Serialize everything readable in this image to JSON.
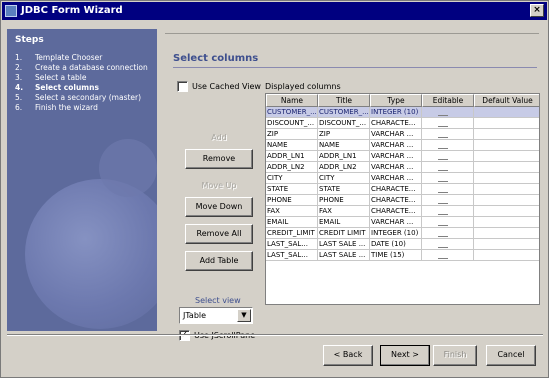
{
  "window": {
    "title": "JDBC Form Wizard",
    "close_glyph": "×"
  },
  "steps": {
    "title": "Steps",
    "items": [
      {
        "num": "1.",
        "label": "Template Chooser"
      },
      {
        "num": "2.",
        "label": "Create a database connection"
      },
      {
        "num": "3.",
        "label": "Select a table"
      },
      {
        "num": "4.",
        "label": "Select columns"
      },
      {
        "num": "5.",
        "label": "Select a secondary (master)"
      },
      {
        "num": "6.",
        "label": "Finish the wizard"
      }
    ],
    "current_index": 3
  },
  "panel": {
    "heading": "Select columns",
    "use_cached_view_label": "Use Cached View",
    "use_cached_view_checked": false,
    "displayed_columns_label": "Displayed columns",
    "buttons": {
      "add": "Add",
      "remove": "Remove",
      "move_up": "Move Up",
      "move_down": "Move Down",
      "remove_all": "Remove All",
      "add_all": "Add Table"
    },
    "select_view_label": "Select view",
    "select_view_value": "JTable",
    "select_view_arrow": "▼",
    "use_jscrollpane_label": "Use JScrollPane",
    "use_jscrollpane_checked": true,
    "use_jscrollpane_check_glyph": "✓"
  },
  "table": {
    "columns": [
      "Name",
      "Title",
      "Type",
      "Editable",
      "Default Value"
    ],
    "rows": [
      [
        "CUSTOMER_...",
        "CUSTOMER_...",
        "INTEGER (10)",
        "",
        ""
      ],
      [
        "DISCOUNT_...",
        "DISCOUNT_...",
        "CHARACTE...",
        "",
        ""
      ],
      [
        "ZIP",
        "ZIP",
        "VARCHAR ...",
        "",
        ""
      ],
      [
        "NAME",
        "NAME",
        "VARCHAR ...",
        "",
        ""
      ],
      [
        "ADDR_LN1",
        "ADDR_LN1",
        "VARCHAR ...",
        "",
        ""
      ],
      [
        "ADDR_LN2",
        "ADDR_LN2",
        "VARCHAR ...",
        "",
        ""
      ],
      [
        "CITY",
        "CITY",
        "VARCHAR ...",
        "",
        ""
      ],
      [
        "STATE",
        "STATE",
        "CHARACTE...",
        "",
        ""
      ],
      [
        "PHONE",
        "PHONE",
        "CHARACTE...",
        "",
        ""
      ],
      [
        "FAX",
        "FAX",
        "CHARACTE...",
        "",
        ""
      ],
      [
        "EMAIL",
        "EMAIL",
        "VARCHAR ...",
        "",
        ""
      ],
      [
        "CREDIT_LIMIT",
        "CREDIT LIMIT",
        "INTEGER (10)",
        "",
        ""
      ],
      [
        "LAST_SAL...",
        "LAST SALE ...",
        "DATE (10)",
        "",
        ""
      ],
      [
        "LAST_SAL...",
        "LAST SALE ...",
        "TIME (15)",
        "",
        ""
      ]
    ],
    "selected_row": 0
  },
  "footer": {
    "back": "< Back",
    "next": "Next >",
    "finish": "Finish",
    "cancel": "Cancel"
  },
  "colors": {
    "title_bar": "#000080",
    "steps_panel": "#5d6a9c",
    "heading": "#3e4f8e",
    "selected_row": "#c7cbe6"
  }
}
